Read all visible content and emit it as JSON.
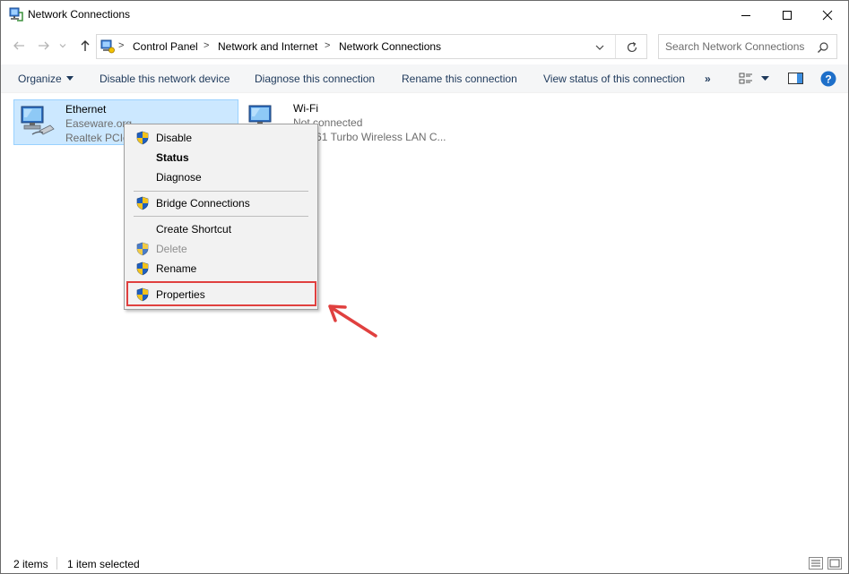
{
  "window": {
    "title": "Network Connections"
  },
  "address": {
    "crumbs": [
      "Control Panel",
      "Network and Internet",
      "Network Connections"
    ],
    "separator": ">",
    "search_placeholder": "Search Network Connections"
  },
  "toolbar": {
    "organize": "Organize",
    "disable": "Disable this network device",
    "diagnose": "Diagnose this connection",
    "rename": "Rename this connection",
    "view_status": "View status of this connection",
    "more": "»"
  },
  "items": [
    {
      "name": "Ethernet",
      "line2": "Easeware.org",
      "line3": "Realtek PCIe",
      "selected": true
    },
    {
      "name": "Wi-Fi",
      "line2": "Not connected",
      "line3": "k RT61 Turbo Wireless LAN C..."
    }
  ],
  "context_menu": {
    "items": [
      {
        "label": "Disable",
        "shield": true
      },
      {
        "label": "Status",
        "bold": true
      },
      {
        "label": "Diagnose"
      },
      {
        "label": "Bridge Connections",
        "shield": true
      },
      {
        "label": "Create Shortcut"
      },
      {
        "label": "Delete",
        "shield": true,
        "disabled": true
      },
      {
        "label": "Rename",
        "shield": true
      },
      {
        "label": "Properties",
        "shield": true,
        "highlighted": true
      }
    ]
  },
  "statusbar": {
    "count": "2 items",
    "selection": "1 item selected"
  },
  "colors": {
    "selection_bg": "#cce8ff",
    "highlight_red": "#e0403f",
    "toolbar_text": "#1e395b",
    "help_blue": "#1e6fc9"
  }
}
